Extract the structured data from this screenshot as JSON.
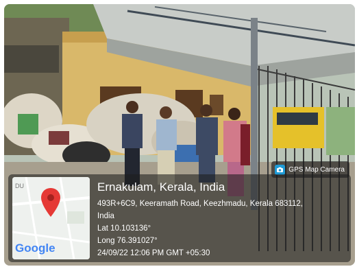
{
  "overlay": {
    "app_badge": "GPS Map Camera",
    "map_label": "DU",
    "map_brand": "Google",
    "location_title": "Ernakulam, Kerala, India",
    "address_line_1": "493R+6C9, Keeramath Road, Keezhmadu, Kerala 683112,",
    "address_line_2": "India",
    "latitude": "Lat 10.103136°",
    "longitude": "Long 76.391027°",
    "datetime": "24/09/22 12:06 PM GMT +05:30"
  },
  "colors": {
    "pin": "#e53935",
    "google_blue": "#4285f4",
    "overlay_bg": "#1e1e1e"
  },
  "icons": [
    "camera-icon",
    "map-pin-icon"
  ]
}
